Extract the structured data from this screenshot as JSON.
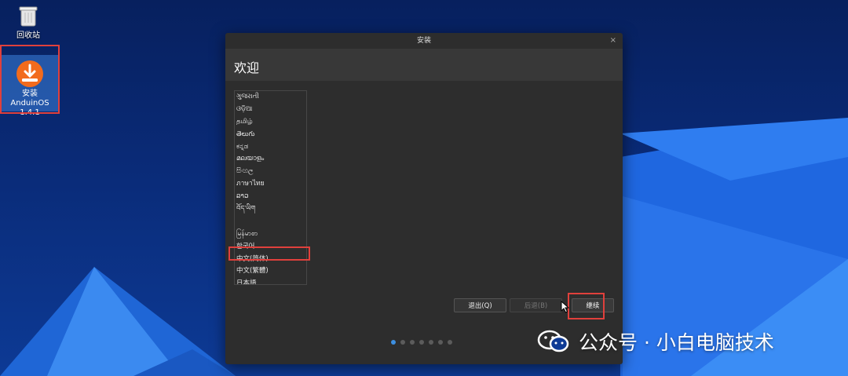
{
  "desktop": {
    "trash_label": "回收站",
    "installer_label_1": "安装 AnduinOS",
    "installer_label_2": "1.4.1"
  },
  "window": {
    "title": "安装",
    "close": "×",
    "heading": "欢迎"
  },
  "languages": [
    "ગુજરાતી",
    "ଓଡ଼ିଆ",
    "தமிழ்",
    "తెలుగు",
    "ಕನ್ನಡ",
    "മലയാളം",
    "සිංහල",
    "ภาษาไทย",
    "ລາວ",
    "བོད་ཡིག",
    "",
    "မြန်မာစာ",
    "한국어",
    "中文(简体)",
    "中文(繁體)",
    "日本語"
  ],
  "selected_language": "中文(简体)",
  "buttons": {
    "quit": "退出(Q)",
    "back": "后退(B)",
    "continue": "继续"
  },
  "progress": {
    "current_step": 1,
    "total_steps": 7
  },
  "watermark": {
    "text": "公众号 · 小白电脑技术"
  },
  "colors": {
    "highlight": "#e0403c",
    "accent": "#3d8fe0",
    "window_bg": "#2d2d2d"
  }
}
